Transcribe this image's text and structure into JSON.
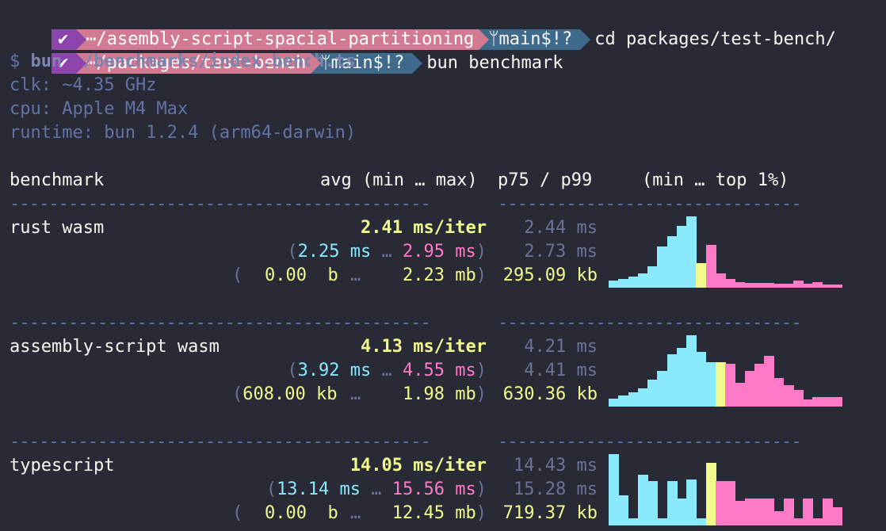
{
  "prompt1": {
    "status_icon": "✔",
    "path": "⋯/asembly-script-spacial-partitioning",
    "branch": "main$!?",
    "command": "cd packages/test-bench/"
  },
  "prompt2": {
    "status_icon": "✔",
    "path": "⋯/packages/test-bench",
    "branch": "main$!?",
    "command": "bun benchmark"
  },
  "run_line": {
    "dollar": "$",
    "command": "bun ./benchmarks/index.bench.ts"
  },
  "env": {
    "clk": "clk: ~4.35 GHz",
    "cpu": "cpu: Apple M4 Max",
    "runtime": "runtime: bun 1.2.4 (arm64-darwin)"
  },
  "header": {
    "benchmark": "benchmark",
    "avg": "avg (min … max)",
    "pct": "p75 / p99",
    "dist": "(min … top 1%)"
  },
  "separator": {
    "left": "-------------------------------------------",
    "right": "-------------------------------"
  },
  "colors": {
    "fast": "#8be9fd",
    "median": "#f1fa8c",
    "slow": "#ff79c6",
    "background": "#282a36"
  },
  "rows": [
    {
      "name": "rust wasm",
      "avg": "2.41 ms/iter",
      "min": "2.25 ms",
      "max": "2.95 ms",
      "p75": "2.44 ms",
      "p99": "2.73 ms",
      "mem_min": "0.00  b",
      "mem_max": "2.23 mb",
      "mem_p": "295.09 kb",
      "hist": {
        "values": [
          0.1,
          0.12,
          0.15,
          0.2,
          0.3,
          0.58,
          0.72,
          0.87,
          1.0,
          0.35,
          0.6,
          0.2,
          0.12,
          0.08,
          0.07,
          0.07,
          0.07,
          0.06,
          0.06,
          0.1,
          0.05,
          0.08,
          0.04,
          0.04
        ],
        "median_index": 8,
        "median_color_index": 9
      }
    },
    {
      "name": "assembly-script wasm",
      "avg": "4.13 ms/iter",
      "min": "3.92 ms",
      "max": "4.55 ms",
      "p75": "4.21 ms",
      "p99": "4.41 ms",
      "mem_min": "608.00 kb",
      "mem_max": "1.98 mb",
      "mem_p": "630.36 kb",
      "hist": {
        "values": [
          0.11,
          0.15,
          0.2,
          0.25,
          0.38,
          0.5,
          0.73,
          0.82,
          1.0,
          0.77,
          0.62,
          0.62,
          0.6,
          0.33,
          0.5,
          0.6,
          0.71,
          0.4,
          0.3,
          0.23,
          0.1,
          0.13,
          0.13,
          0.13
        ],
        "median_index": 11,
        "median_color_index": 11
      }
    },
    {
      "name": "typescript",
      "avg": "14.05 ms/iter",
      "min": "13.14 ms",
      "max": "15.56 ms",
      "p75": "14.43 ms",
      "p99": "15.28 ms",
      "mem_min": "0.00  b",
      "mem_max": "12.45 mb",
      "mem_p": "719.37 kb",
      "hist": {
        "values": [
          1.0,
          0.42,
          0.1,
          0.71,
          0.62,
          0.1,
          0.62,
          0.38,
          0.64,
          0.1,
          0.88,
          0.62,
          0.62,
          0.35,
          0.38,
          0.38,
          0.38,
          0.2,
          0.38,
          0.1,
          0.38,
          0.1,
          0.38,
          0.25
        ],
        "median_index": 10,
        "median_color_index": 10
      }
    }
  ]
}
